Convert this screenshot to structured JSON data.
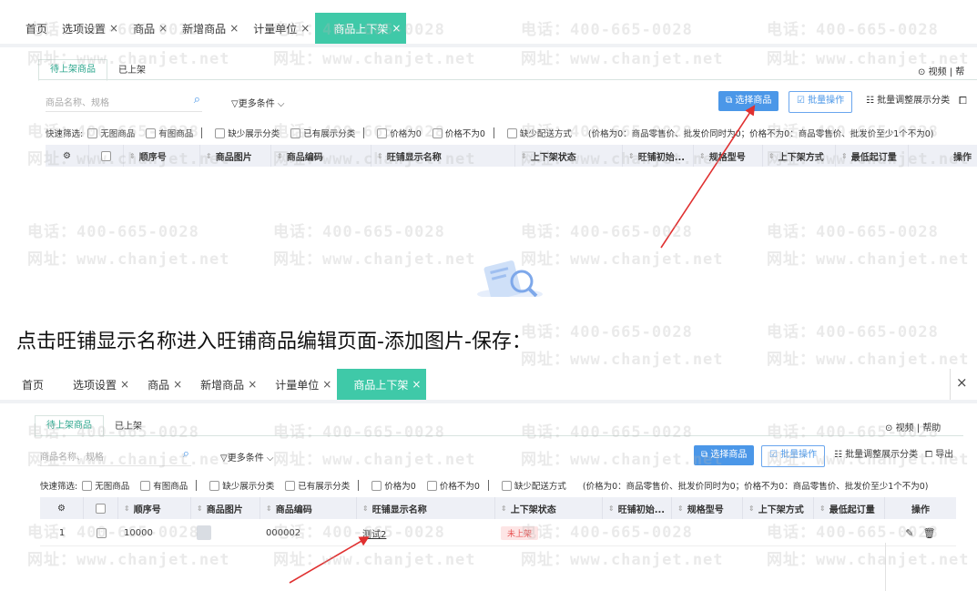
{
  "top_section": {
    "tabs": [
      {
        "label": "首页",
        "close": ""
      },
      {
        "label": "选项设置",
        "close": "×"
      },
      {
        "label": "商品",
        "close": "×"
      },
      {
        "label": "新增商品",
        "close": "×"
      },
      {
        "label": "计量单位",
        "close": "×"
      },
      {
        "label": "商品上下架",
        "close": "×"
      }
    ],
    "subtabs": [
      "待上架商品",
      "已上架"
    ],
    "right_links": "视频 | 帮",
    "search_placeholder": "商品名称、规格",
    "more_filters": "更多条件",
    "select_goods_button": "选择商品",
    "batch_button": "批量操作",
    "batch_adjust_button": "批量调整展示分类",
    "quick_filter_label": "快速筛选:",
    "filters": [
      "无图商品",
      "有图商品",
      "缺少展示分类",
      "已有展示分类",
      "价格为0",
      "价格不为0",
      "缺少配送方式"
    ],
    "price_note": "(价格为0：商品零售价、批发价同时为0；价格不为0：商品零售价、批发价至少1个不为0)",
    "columns": [
      "顺序号",
      "商品图片",
      "商品编码",
      "旺铺显示名称",
      "上下架状态",
      "旺铺初始...",
      "规格型号",
      "上下架方式",
      "最低起订量",
      "操作"
    ]
  },
  "caption": "点击旺铺显示名称进入旺铺商品编辑页面-添加图片-保存：",
  "bottom_section": {
    "tabs": [
      {
        "label": "首页",
        "close": ""
      },
      {
        "label": "选项设置",
        "close": "×"
      },
      {
        "label": "商品",
        "close": "×"
      },
      {
        "label": "新增商品",
        "close": "×"
      },
      {
        "label": "计量单位",
        "close": "×"
      },
      {
        "label": "商品上下架",
        "close": "×"
      }
    ],
    "window_close": "×",
    "subtabs": [
      "待上架商品",
      "已上架"
    ],
    "right_links": "视频 | 帮助",
    "search_placeholder": "商品名称、规格",
    "more_filters": "更多条件",
    "select_goods_button": "选择商品",
    "batch_button": "批量操作",
    "batch_adjust_button": "批量调整展示分类",
    "export_button": "导出",
    "quick_filter_label": "快速筛选:",
    "filters": [
      "无图商品",
      "有图商品",
      "缺少展示分类",
      "已有展示分类",
      "价格为0",
      "价格不为0",
      "缺少配送方式"
    ],
    "price_note": "(价格为0：商品零售价、批发价同时为0；价格不为0：商品零售价、批发价至少1个不为0)",
    "columns": [
      "顺序号",
      "商品图片",
      "商品编码",
      "旺铺显示名称",
      "上下架状态",
      "旺铺初始...",
      "规格型号",
      "上下架方式",
      "最低起订量",
      "操作"
    ],
    "row": {
      "index": "1",
      "order": "10000",
      "code": "000002",
      "name": "测试2",
      "status": "未上架"
    }
  },
  "watermarks": {
    "phone": "电话：400-665-0028",
    "site": "网址：www.chanjet.net"
  },
  "colors": {
    "active_tab": "#3fc9a8",
    "primary": "#4b97e8",
    "arrow": "#e03030",
    "status_red": "#e85454"
  }
}
